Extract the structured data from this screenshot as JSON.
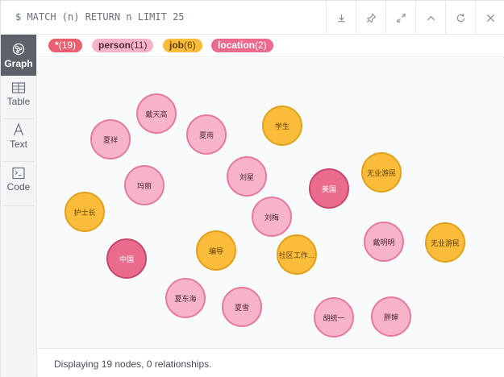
{
  "query": "$ MATCH (n) RETURN n LIMIT 25",
  "toolbar": {
    "icons": [
      "download-icon",
      "pin-icon",
      "expand-icon",
      "collapse-icon",
      "rerun-icon",
      "close-icon"
    ]
  },
  "views": [
    {
      "label": "Graph",
      "icon": "graph-icon",
      "active": true
    },
    {
      "label": "Table",
      "icon": "table-icon",
      "active": false
    },
    {
      "label": "Text",
      "icon": "text-icon",
      "active": false
    },
    {
      "label": "Code",
      "icon": "code-icon",
      "active": false
    }
  ],
  "labels": [
    {
      "name": "*",
      "count": "(19)",
      "color": "#eb5e6f",
      "text_color": "#ffffff"
    },
    {
      "name": "person",
      "count": "(11)",
      "color": "#f7b3c8",
      "text_color": "#4d2a35"
    },
    {
      "name": "job",
      "count": "(6)",
      "color": "#fbbc3b",
      "text_color": "#5a3d05"
    },
    {
      "name": "location",
      "count": "(2)",
      "color": "#eb6b8e",
      "text_color": "#ffffff"
    }
  ],
  "nodes": [
    {
      "label": "戴天高",
      "type": "person"
    },
    {
      "label": "夏祥",
      "type": "person"
    },
    {
      "label": "夏雨",
      "type": "person"
    },
    {
      "label": "学生",
      "type": "job"
    },
    {
      "label": "玛丽",
      "type": "person"
    },
    {
      "label": "刘星",
      "type": "person"
    },
    {
      "label": "美国",
      "type": "location"
    },
    {
      "label": "无业游民",
      "type": "job"
    },
    {
      "label": "护士长",
      "type": "job"
    },
    {
      "label": "刘梅",
      "type": "person"
    },
    {
      "label": "戴明明",
      "type": "person"
    },
    {
      "label": "无业游民",
      "type": "job"
    },
    {
      "label": "中国",
      "type": "location"
    },
    {
      "label": "编导",
      "type": "job"
    },
    {
      "label": "社区工作...",
      "type": "job"
    },
    {
      "label": "夏东海",
      "type": "person"
    },
    {
      "label": "夏雪",
      "type": "person"
    },
    {
      "label": "胡统一",
      "type": "person"
    },
    {
      "label": "胖婶",
      "type": "person"
    }
  ],
  "status": "Displaying 19 nodes, 0 relationships."
}
